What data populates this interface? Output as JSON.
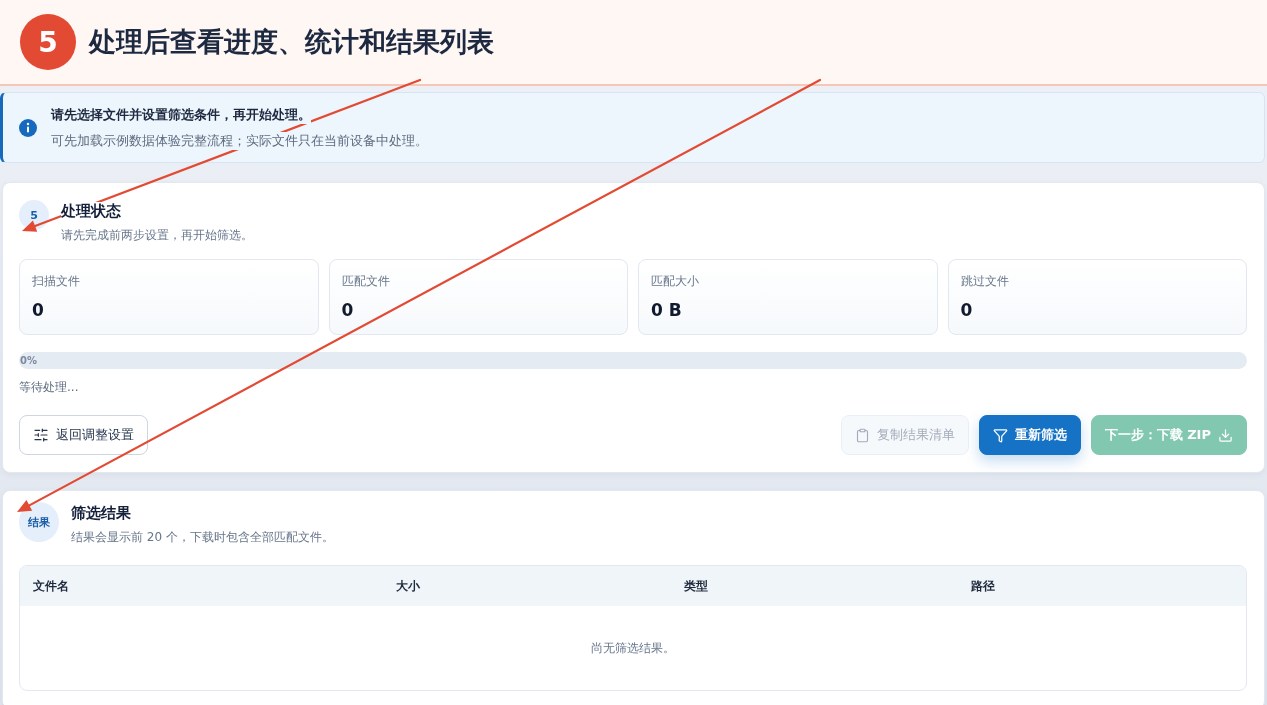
{
  "header": {
    "step": "5",
    "title": "处理后查看进度、统计和结果列表"
  },
  "notice": {
    "title": "请先选择文件并设置筛选条件，再开始处理。",
    "text": "可先加载示例数据体验完整流程；实际文件只在当前设备中处理。"
  },
  "status_panel": {
    "step": "5",
    "title": "处理状态",
    "subtitle": "请先完成前两步设置，再开始筛选。",
    "stats": [
      {
        "label": "扫描文件",
        "value": "0"
      },
      {
        "label": "匹配文件",
        "value": "0"
      },
      {
        "label": "匹配大小",
        "value": "0 B"
      },
      {
        "label": "跳过文件",
        "value": "0"
      }
    ],
    "progress": {
      "level": 0,
      "label": "0%"
    },
    "status_text": "等待处理...",
    "buttons": [
      {
        "label": "返回调整设置",
        "kind": "outline",
        "disabled": false
      },
      {
        "label": "复制结果清单",
        "kind": "secondary",
        "disabled": true
      },
      {
        "label": "重新筛选",
        "kind": "primary",
        "disabled": false
      },
      {
        "label": "下一步：下载 ZIP",
        "kind": "success",
        "disabled": true
      }
    ]
  },
  "results_panel": {
    "step": "结果",
    "title": "筛选结果",
    "subtitle": "结果会显示前 20 个，下载时包含全部匹配文件。",
    "table": {
      "columns": [
        "文件名",
        "大小",
        "类型",
        "路径"
      ],
      "empty_text": "尚无筛选结果。"
    }
  }
}
